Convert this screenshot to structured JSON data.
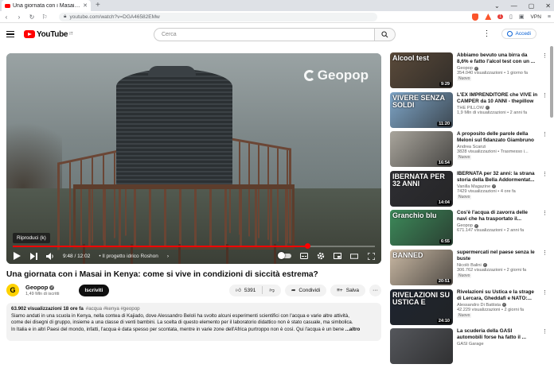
{
  "browser": {
    "tab_title": "Una giornata con i Masai in Kenya: come s",
    "url": "youtube.com/watch?v=DGA46582EMw",
    "badge_count": "1",
    "vpn_label": "VPN"
  },
  "header": {
    "logo_text": "YouTube",
    "country_code": "IT",
    "search_placeholder": "Cerca",
    "signin_label": "Accedi"
  },
  "player": {
    "watermark": "Geopop",
    "tooltip": "Riproduci (k)",
    "time": "9:48 / 12:02",
    "chapter": "• Il progetto idrico Roshon",
    "progress": 0.814
  },
  "video": {
    "title": "Una giornata con i Masai in Kenya: come si vive in condizioni di siccità estrema?",
    "channel": "Geopop",
    "channel_initial": "G",
    "subscribers": "1,49 Mln di iscritti",
    "subscribe_label": "Iscriviti",
    "likes": "5391",
    "share_label": "Condividi",
    "save_label": "Salva"
  },
  "description": {
    "views_date": "63.902 visualizzazioni  18 ore fa",
    "hashtags": "#acqua #kenya #geopop",
    "line1": "Siamo andati in una scuola in Kenya, nella contea di Kajiado, dove Alessandro Beloli ha svolto alcuni esperimenti scientifici con l'acqua e varie altre attività,",
    "line2": "come dei disegni di gruppo, insieme a una classe di venti bambini. La scelta di questo elemento per il laboratorio didattico non è stato casuale, ma simbolica.",
    "line3": "In Italia e in altri Paesi del mondo, infatti, l'acqua è data spesso per scontata, mentre in varie zone dell'Africa purtroppo non è così. Qui l'acqua è un bene",
    "more_label": "...altro"
  },
  "recommendations": [
    {
      "title": "Abbiamo bevuto una birra da 8,6% e fatto l'alcol test con un ...",
      "channel": "Geopop",
      "verified": true,
      "meta": "354.040 visualizzazioni • 1 giorno fa",
      "badge": "Nuovo",
      "duration": "9:29",
      "overlay": "Alcool test",
      "bg": "#5a4a3a"
    },
    {
      "title": "L'EX IMPRENDITORE che VIVE in CAMPER da 10 ANNI - thepillow",
      "channel": "THE PILLOW",
      "verified": true,
      "meta": "1,9 Mln di visualizzazioni • 2 anni fa",
      "badge": "",
      "duration": "11:20",
      "overlay": "VIVERE SENZA SOLDI",
      "bg": "#7fa6c8"
    },
    {
      "title": "A proposito delle parole della Meloni sul fidanzato Giambruno",
      "channel": "Andrea Scanzi",
      "verified": false,
      "meta": "3828 visualizzazioni • Trasmesso i...",
      "badge": "Nuovo",
      "duration": "16:54",
      "overlay": "",
      "bg": "#a9a59c"
    },
    {
      "title": "IBERNATA per 32 anni: la strana storia della Bella Addormentat...",
      "channel": "Vanilla Magazine",
      "verified": true,
      "meta": "7429 visualizzazioni • 4 ore fa",
      "badge": "Nuovo",
      "duration": "14:04",
      "overlay": "IBERNATA PER 32 ANNI",
      "bg": "#2e2e33"
    },
    {
      "title": "Cos'è l'acqua di zavorra delle navi che ha trasportato il...",
      "channel": "Geopop",
      "verified": true,
      "meta": "671.147 visualizzazioni • 2 anni fa",
      "badge": "",
      "duration": "6:55",
      "overlay": "Granchio blu",
      "bg": "#3d8a5a"
    },
    {
      "title": "supermercati nel paese senza le buste",
      "channel": "Nicolò Balini",
      "verified": true,
      "meta": "306.762 visualizzazioni • 2 giorni fa",
      "badge": "Nuovo",
      "duration": "20:51",
      "overlay": "BANNED",
      "bg": "#c9b8a3"
    },
    {
      "title": "Rivelazioni su Ustica e la strage di Lercara, Gheddafi e NATO:...",
      "channel": "Alessandro Di Battista",
      "verified": true,
      "meta": "42.229 visualizzazioni • 2 giorni fa",
      "badge": "Nuovo",
      "duration": "24:10",
      "overlay": "RIVELAZIONI SU USTICA E",
      "bg": "#1e2530"
    },
    {
      "title": "La scuderia della GASI automobili forse ha fatto il ...",
      "channel": "GASI Garage",
      "verified": false,
      "meta": "",
      "badge": "",
      "duration": "",
      "overlay": "",
      "bg": "#55575c"
    }
  ],
  "colors": {
    "brand_red": "#ff0000",
    "link_blue": "#065fd4",
    "geopop_yellow": "#ffd200"
  }
}
